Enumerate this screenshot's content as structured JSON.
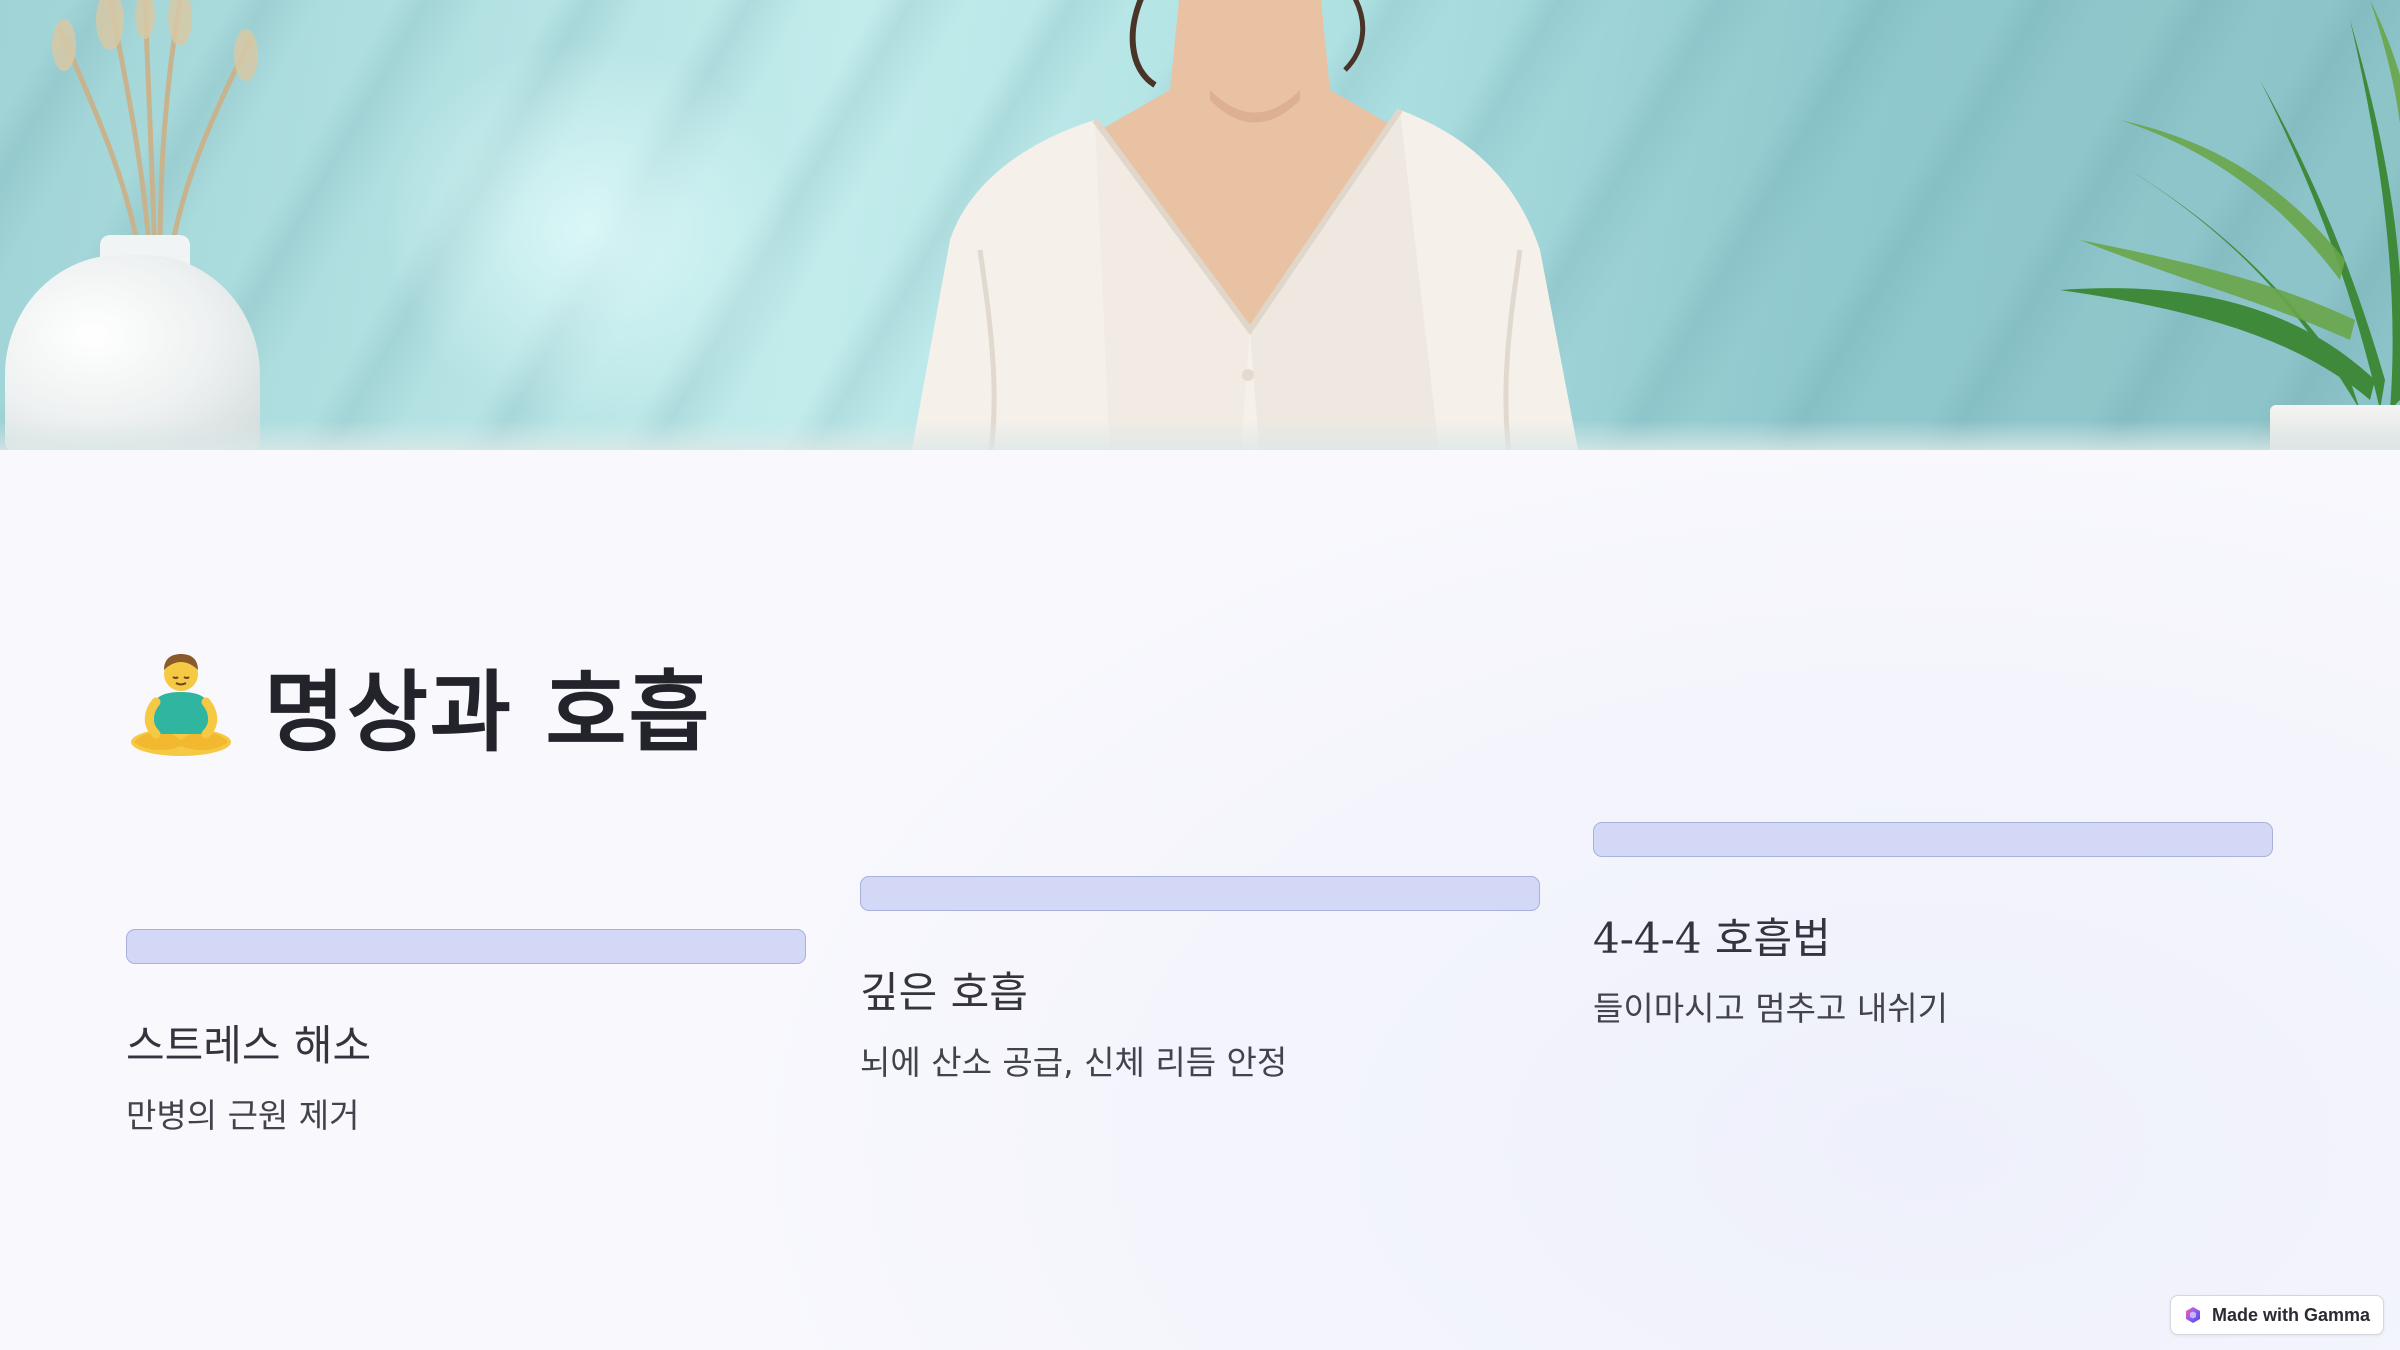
{
  "slide": {
    "hero": {
      "image_subject": "woman-in-white-blouse-meditating-photo"
    },
    "title": {
      "emoji_icon": "meditating-person-emoji-icon",
      "text": "명상과 호흡"
    },
    "steps": [
      {
        "title": "스트레스 해소",
        "description": "만병의 근원 제거"
      },
      {
        "title": "깊은 호흡",
        "description": "뇌에 산소 공급, 신체 리듬 안정"
      },
      {
        "title": "4-4-4 호흡법",
        "description": "들이마시고 멈추고 내쉬기"
      }
    ],
    "colors": {
      "background": "#f8f8fd",
      "step_bar_fill": "#d3d8f6",
      "step_bar_border": "#a9b0dc",
      "title_text": "#23232b"
    }
  },
  "badge": {
    "icon": "gamma-logo-icon",
    "label": "Made with Gamma"
  }
}
